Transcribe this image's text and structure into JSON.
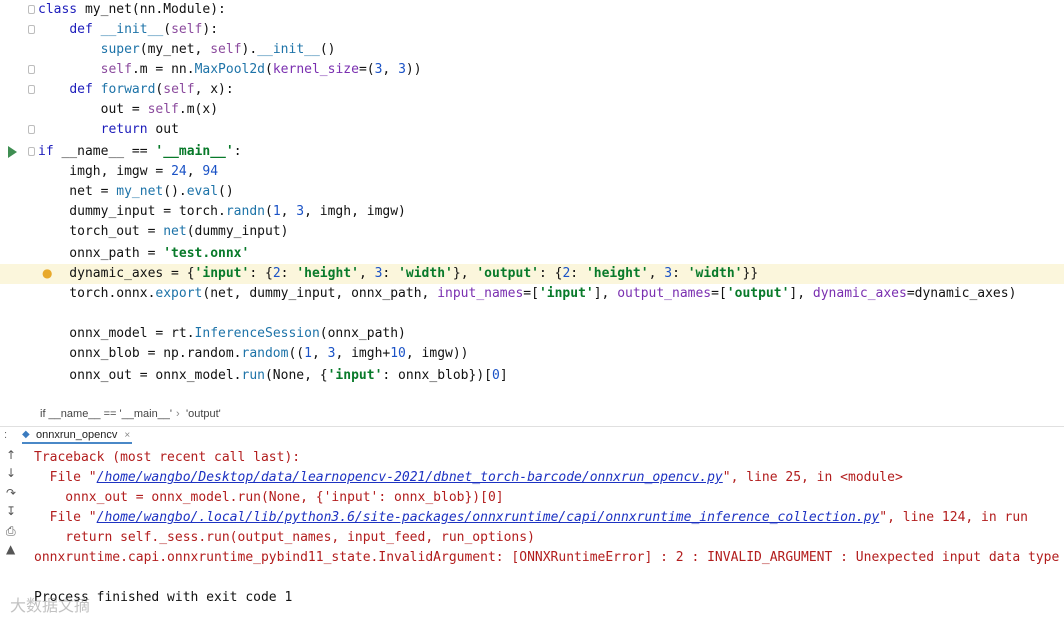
{
  "breadcrumb": {
    "item1": "if __name__ == '__main__'",
    "sep": "›",
    "item2": "'output'"
  },
  "run_tab": {
    "label": "onnxrun_opencv",
    "close": "×"
  },
  "console": {
    "line1": "Traceback (most recent call last):",
    "line2_pre": "  File \"",
    "line2_link": "/home/wangbo/Desktop/data/learnopencv-2021/dbnet_torch-barcode/onnxrun_opencv.py",
    "line2_post": "\", line 25, in <module>",
    "line3": "    onnx_out = onnx_model.run(None, {'input': onnx_blob})[0]",
    "line4_pre": "  File \"",
    "line4_link": "/home/wangbo/.local/lib/python3.6/site-packages/onnxruntime/capi/onnxruntime_inference_collection.py",
    "line4_post": "\", line 124, in run",
    "line5": "    return self._sess.run(output_names, input_feed, run_options)",
    "line6": "onnxruntime.capi.onnxruntime_pybind11_state.InvalidArgument: [ONNXRuntimeError] : 2 : INVALID_ARGUMENT : Unexpected input data type",
    "line7": "Process finished with exit code 1"
  },
  "watermark": "大数据文摘",
  "icons": [
    "run-icon",
    "fold-icon",
    "bulb-icon",
    "rerun-icon",
    "down-icon",
    "wrap-icon",
    "scroll-icon",
    "print-icon",
    "trash-icon",
    "python-file-icon"
  ]
}
